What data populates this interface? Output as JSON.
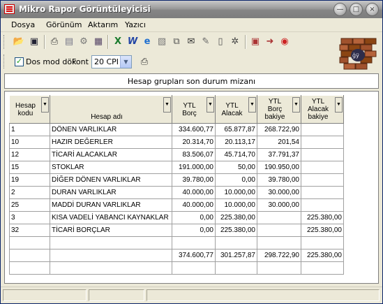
{
  "window": {
    "title": "Mikro Rapor Görüntüleyicisi"
  },
  "titlebar_buttons": [
    "minimize-icon",
    "maximize-icon",
    "close-icon"
  ],
  "menu": {
    "items": [
      "Dosya",
      "Görünüm",
      "Aktarım",
      "Yazıcı"
    ]
  },
  "toolbar": {
    "icons": [
      "open-folder-icon",
      "save-disk-icon",
      "print-icon",
      "print-preview-icon",
      "settings-icon",
      "books-icon",
      "excel-icon",
      "word-icon",
      "internet-explorer-icon",
      "export-document-icon",
      "copy-document-icon",
      "mail-icon",
      "edit-icon",
      "blank-page-icon",
      "gear-icon",
      "tree-icon",
      "exit-icon",
      "help-icon"
    ],
    "dos_mode_label": "Dos mod dök",
    "dos_mode_checked": true,
    "font_label": "Font",
    "font_value": "20 CPI"
  },
  "report": {
    "title": "Hesap grupları son durum mizanı",
    "columns": [
      {
        "label1": "Hesap",
        "label2": "kodu"
      },
      {
        "label1": "",
        "label2": "Hesap adı"
      },
      {
        "label1": "YTL",
        "label2": "Borç"
      },
      {
        "label1": "YTL",
        "label2": "Alacak"
      },
      {
        "label1": "YTL",
        "label2": "Borç",
        "label3": "bakiye"
      },
      {
        "label1": "YTL",
        "label2": "Alacak",
        "label3": "bakiye"
      }
    ],
    "rows": [
      [
        "1",
        "DÖNEN VARLIKLAR",
        "334.600,77",
        "65.877,87",
        "268.722,90",
        ""
      ],
      [
        "10",
        "HAZIR DEĞERLER",
        "20.314,70",
        "20.113,17",
        "201,54",
        ""
      ],
      [
        "12",
        "TİCARİ ALACAKLAR",
        "83.506,07",
        "45.714,70",
        "37.791,37",
        ""
      ],
      [
        "15",
        "STOKLAR",
        "191.000,00",
        "50,00",
        "190.950,00",
        ""
      ],
      [
        "19",
        "DİĞER DÖNEN VARLIKLAR",
        "39.780,00",
        "0,00",
        "39.780,00",
        ""
      ],
      [
        "2",
        "DURAN VARLIKLAR",
        "40.000,00",
        "10.000,00",
        "30.000,00",
        ""
      ],
      [
        "25",
        "MADDİ DURAN VARLIKLAR",
        "40.000,00",
        "10.000,00",
        "30.000,00",
        ""
      ],
      [
        "3",
        "KISA VADELİ YABANCI KAYNAKLAR",
        "0,00",
        "225.380,00",
        "",
        "225.380,00"
      ],
      [
        "32",
        "TİCARİ BORÇLAR",
        "0,00",
        "225.380,00",
        "",
        "225.380,00"
      ]
    ],
    "totals": [
      "",
      "",
      "374.600,77",
      "301.257,87",
      "298.722,90",
      "225.380,00"
    ]
  },
  "status": {
    "panes": [
      "",
      "",
      ""
    ]
  }
}
